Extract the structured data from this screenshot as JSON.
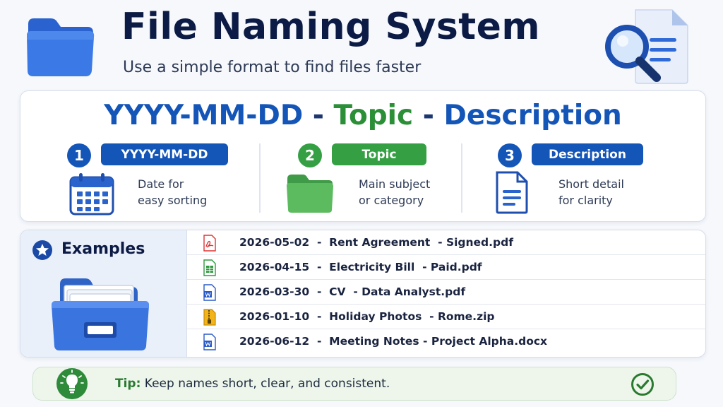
{
  "header": {
    "title": "File Naming System",
    "subtitle": "Use a simple format to find files faster"
  },
  "format": {
    "pattern_date": "YYYY-MM-DD",
    "pattern_sep1": " - ",
    "pattern_topic": "Topic",
    "pattern_sep2": " - ",
    "pattern_description": "Description",
    "columns": [
      {
        "number": "1",
        "label": "YYYY-MM-DD",
        "line1": "Date for",
        "line2": "easy sorting",
        "icon": "calendar-icon",
        "color": "#1455b8"
      },
      {
        "number": "2",
        "label": "Topic",
        "line1": "Main subject",
        "line2": "or category",
        "icon": "green-folder-icon",
        "color": "#34a043"
      },
      {
        "number": "3",
        "label": "Description",
        "line1": "Short detail",
        "line2": "for clarity",
        "icon": "document-icon",
        "color": "#1455b8"
      }
    ]
  },
  "examples": {
    "title": "Examples",
    "items": [
      {
        "text": "2026-05-02  -  Rent Agreement  - Signed.pdf",
        "icon": "pdf-icon"
      },
      {
        "text": "2026-04-15  -  Electricity Bill  - Paid.pdf",
        "icon": "spreadsheet-icon"
      },
      {
        "text": "2026-03-30  -  CV  - Data Analyst.pdf",
        "icon": "word-doc-icon"
      },
      {
        "text": "2026-01-10  -  Holiday Photos  - Rome.zip",
        "icon": "zip-icon"
      },
      {
        "text": "2026-06-12  -  Meeting Notes - Project Alpha.docx",
        "icon": "word-doc-icon"
      }
    ]
  },
  "tip": {
    "label": "Tip:",
    "text": " Keep names short, clear, and consistent."
  },
  "colors": {
    "blue": "#1455b8",
    "green": "#2a8f36",
    "navy": "#0c1b45"
  }
}
